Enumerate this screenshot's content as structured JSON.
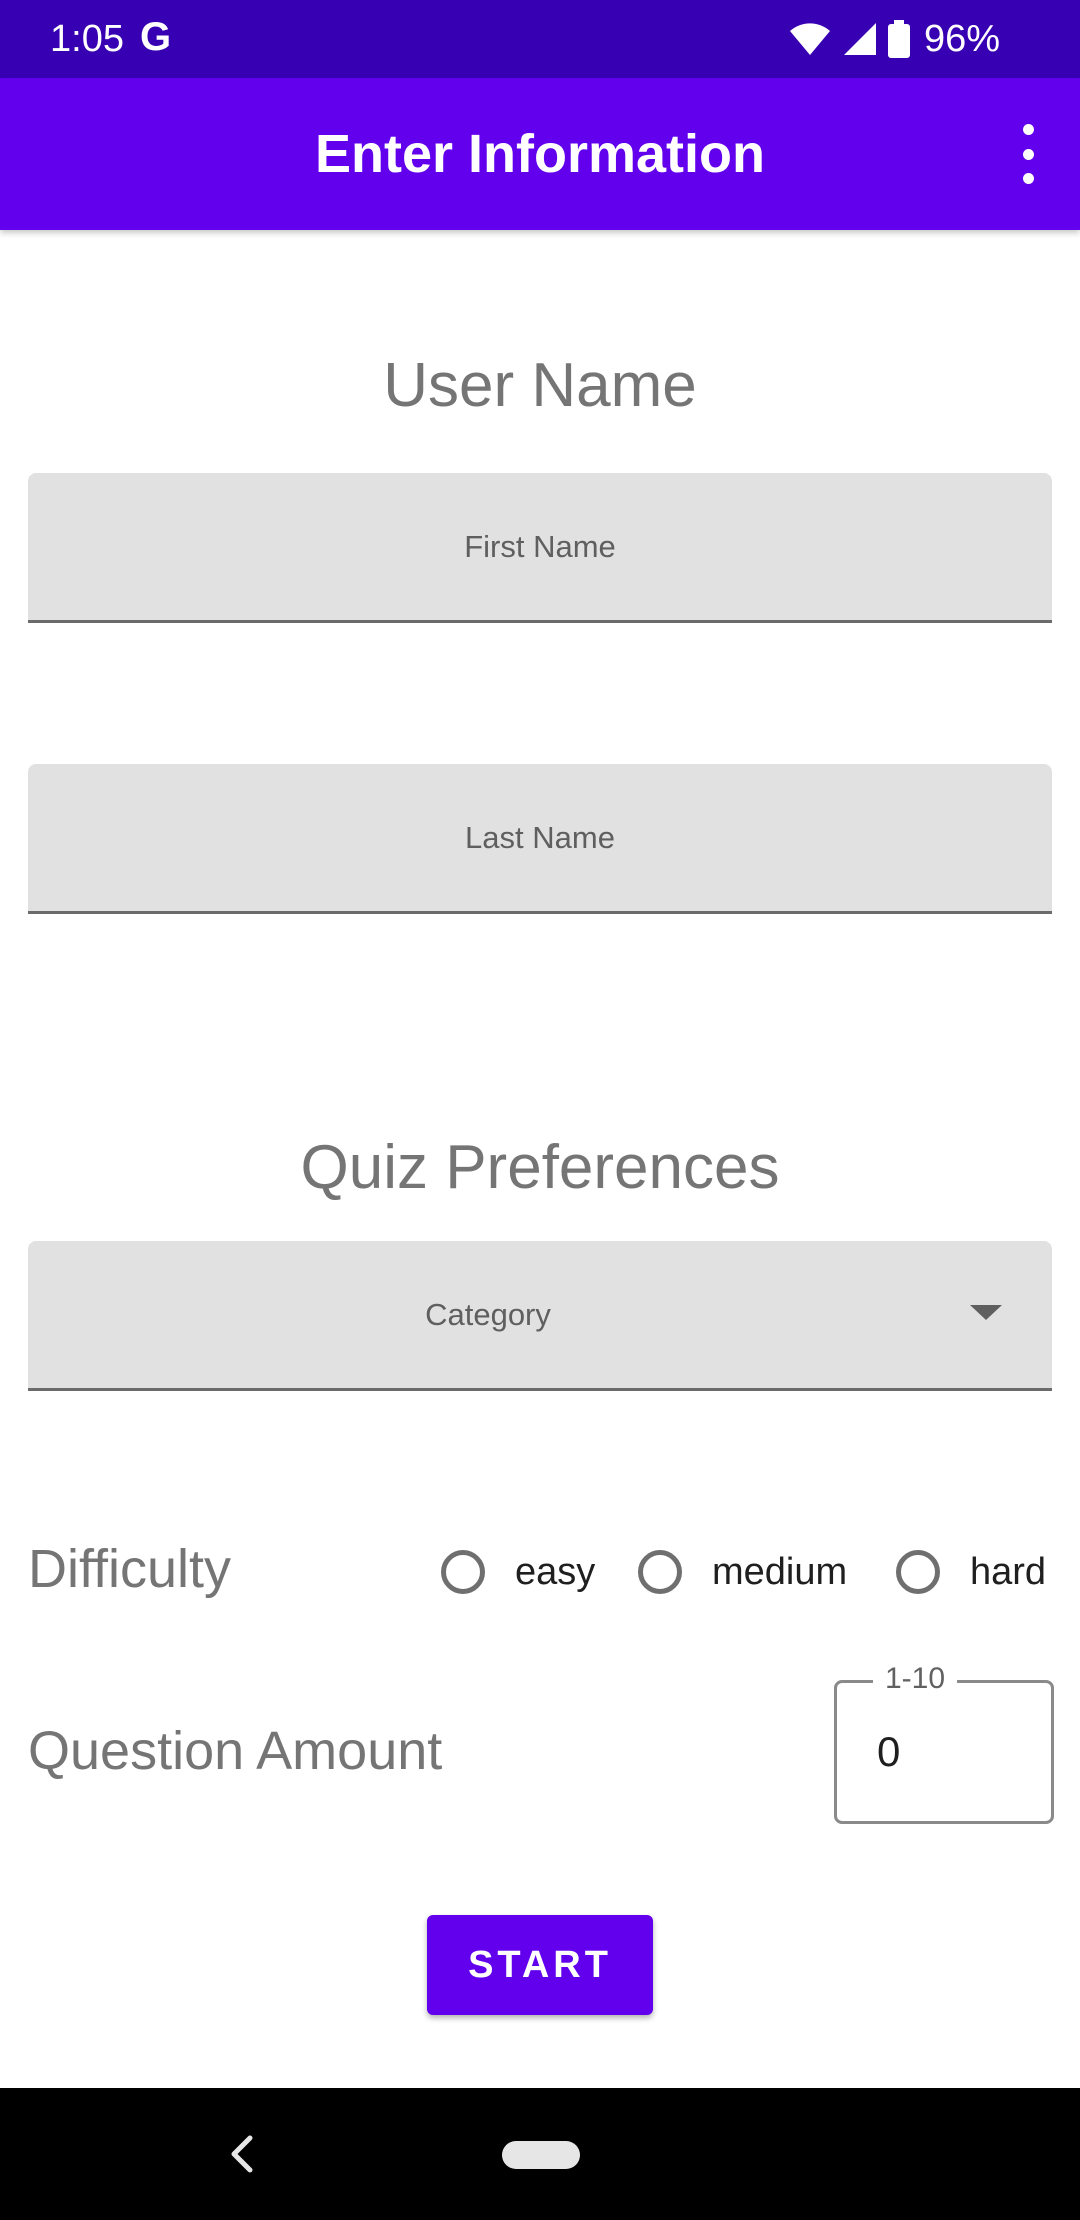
{
  "status_bar": {
    "time": "1:05",
    "google_icon_text": "G",
    "battery_percent": "96%",
    "icons": [
      "wifi-icon",
      "signal-icon",
      "battery-icon"
    ]
  },
  "app_bar": {
    "title": "Enter Information",
    "menu_icon": "overflow-menu-icon",
    "background": "#6200ee"
  },
  "user_section": {
    "title": "User Name",
    "first_name_placeholder": "First Name",
    "last_name_placeholder": "Last Name"
  },
  "quiz_section": {
    "title": "Quiz Preferences",
    "category_placeholder": "Category",
    "difficulty": {
      "label": "Difficulty",
      "options": [
        "easy",
        "medium",
        "hard"
      ],
      "selected": null
    },
    "question_amount": {
      "label": "Question Amount",
      "hint": "1-10",
      "value": "0"
    }
  },
  "start_button": {
    "label": "START"
  },
  "nav_bar": {
    "icons": [
      "back-icon",
      "home-icon"
    ]
  },
  "colors": {
    "primary": "#6200ee",
    "primary_dark": "#3700b3",
    "field_background": "#e1e1e1",
    "secondary_text": "#757575"
  }
}
